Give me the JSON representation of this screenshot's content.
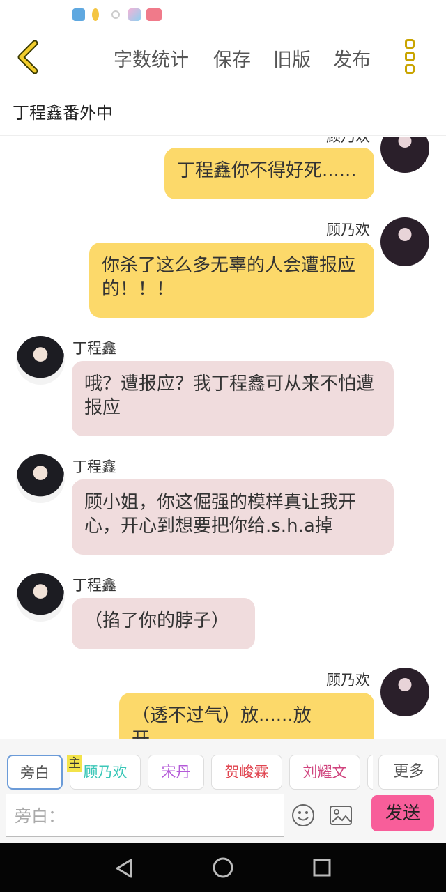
{
  "toolbar": {
    "word_count": "字数统计",
    "save": "保存",
    "old_version": "旧版",
    "publish": "发布"
  },
  "title": "丁程鑫番外中",
  "messages": [
    {
      "speaker": "顾乃欢",
      "side": "right",
      "text": "丁程鑫你不得好死......"
    },
    {
      "speaker": "顾乃欢",
      "side": "right",
      "text": "你杀了这么多无辜的人会遭报应的！！！"
    },
    {
      "speaker": "丁程鑫",
      "side": "left",
      "text": "哦？遭报应？我丁程鑫可从来不怕遭报应"
    },
    {
      "speaker": "丁程鑫",
      "side": "left",
      "text": "顾小姐，你这倔强的模样真让我开心，开心到想要把你给.s.h.a掉"
    },
    {
      "speaker": "丁程鑫",
      "side": "left",
      "text": "（掐了你的脖子）"
    },
    {
      "speaker": "顾乃欢",
      "side": "right",
      "text": "（透不过气）放......放开......"
    }
  ],
  "characters": [
    {
      "label": "旁白",
      "color": "#555555",
      "selected": true
    },
    {
      "label": "顾乃欢",
      "color": "#3cc7b8",
      "badge": "主"
    },
    {
      "label": "宋丹",
      "color": "#b45ad8"
    },
    {
      "label": "贺峻霖",
      "color": "#e0444f"
    },
    {
      "label": "刘耀文",
      "color": "#d0447e"
    }
  ],
  "more_label": "更多",
  "input": {
    "placeholder": "旁白："
  },
  "send_label": "发送",
  "icons": {
    "back": "chevron-left-icon",
    "menu": "kebab-icon",
    "emoji": "emoji-icon",
    "image": "image-icon",
    "nav_back": "triangle-back-icon",
    "nav_home": "circle-home-icon",
    "nav_recent": "square-recent-icon"
  },
  "colors": {
    "accent": "#fcd96a",
    "left_bubble": "#f0dcdd",
    "send": "#f85e9a"
  }
}
